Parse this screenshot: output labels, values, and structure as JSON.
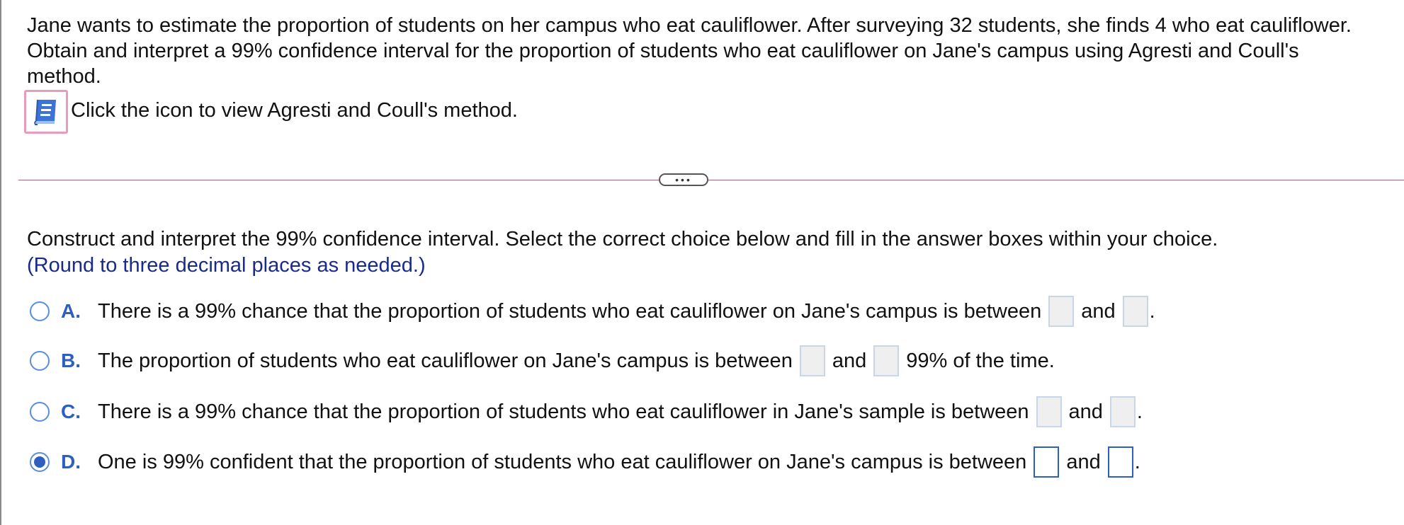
{
  "question": {
    "text": "Jane wants to estimate the proportion of students on her campus who eat cauliflower. After surveying 32 students, she finds 4 who eat cauliflower. Obtain and interpret a 99% confidence interval for the proportion of students who eat cauliflower on Jane's campus using Agresti and Coull's method.",
    "icon_hint": "Click the icon to view Agresti and Coull's method.",
    "icon": "book-icon"
  },
  "divider": {
    "expand_label": "•••"
  },
  "instructions": {
    "text": "Construct and interpret the 99% confidence interval. Select the correct choice below and fill in the answer boxes within your choice.",
    "hint": "(Round to three decimal places as needed.)"
  },
  "choices": [
    {
      "letter": "A.",
      "text_before": "There is a 99% chance that the proportion of students who eat cauliflower on Jane's campus is between",
      "connector": "and",
      "text_after": ".",
      "selected": false
    },
    {
      "letter": "B.",
      "text_before": "The proportion of students who eat cauliflower on Jane's campus is between",
      "connector": "and",
      "text_after": "99% of the time.",
      "selected": false
    },
    {
      "letter": "C.",
      "text_before": "There is a 99% chance that the proportion of students who eat cauliflower in Jane's sample is between",
      "connector": "and",
      "text_after": ".",
      "selected": false
    },
    {
      "letter": "D.",
      "text_before": "One is 99% confident that the proportion of students who eat cauliflower on Jane's campus is between",
      "connector": "and",
      "text_after": ".",
      "selected": true
    }
  ],
  "colors": {
    "accent": "#2d5fc1",
    "hint": "#1a2a8c",
    "icon_highlight": "#e99bbd",
    "divider": "#a4697a"
  }
}
